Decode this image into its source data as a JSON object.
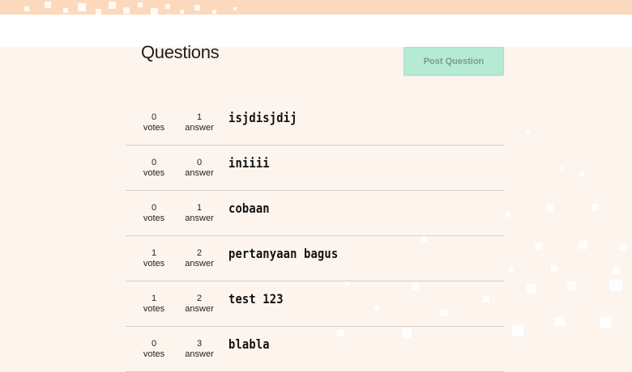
{
  "page": {
    "title": "Questions",
    "post_button_label": "Post Question"
  },
  "questions": [
    {
      "votes": "0",
      "votes_label": "votes",
      "answers": "1",
      "answers_label": "answer",
      "title": "isjdisjdij"
    },
    {
      "votes": "0",
      "votes_label": "votes",
      "answers": "0",
      "answers_label": "answer",
      "title": "iniiii"
    },
    {
      "votes": "0",
      "votes_label": "votes",
      "answers": "1",
      "answers_label": "answer",
      "title": "cobaan"
    },
    {
      "votes": "1",
      "votes_label": "votes",
      "answers": "2",
      "answers_label": "answer",
      "title": "pertanyaan bagus"
    },
    {
      "votes": "1",
      "votes_label": "votes",
      "answers": "2",
      "answers_label": "answer",
      "title": "test 123"
    },
    {
      "votes": "0",
      "votes_label": "votes",
      "answers": "3",
      "answers_label": "answer",
      "title": "blabla"
    }
  ],
  "colors": {
    "background": "#fdf4ee",
    "header_band": "#fcd9bd",
    "button_bg": "#b5ebd4",
    "button_text": "#7c9a8d",
    "divider": "#cfcfcf"
  }
}
